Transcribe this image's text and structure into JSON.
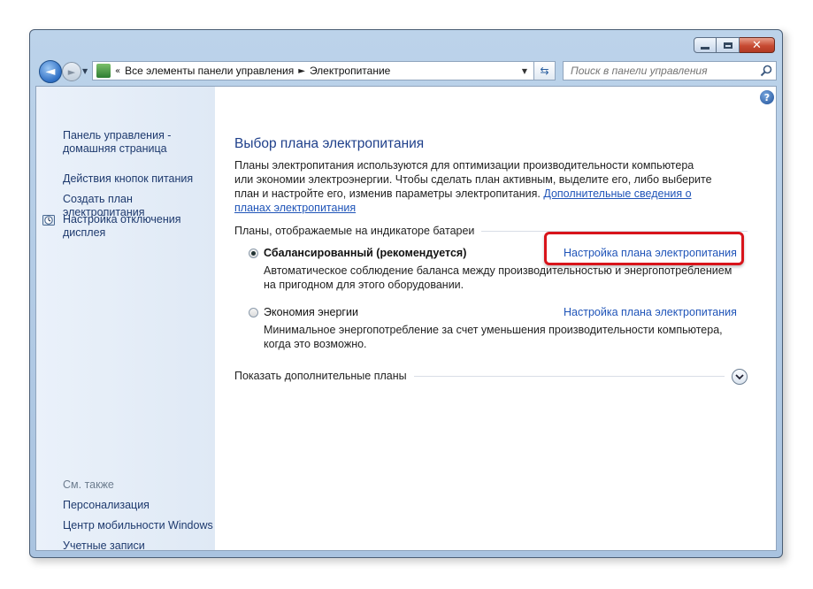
{
  "window": {
    "min_glyph": "minimize",
    "close_glyph": "✕"
  },
  "navbar": {
    "back": "back-arrow",
    "forward": "forward-arrow",
    "breadcrumb": [
      "Все элементы панели управления",
      "Электропитание"
    ],
    "search_placeholder": "Поиск в панели управления"
  },
  "sidebar": {
    "links": [
      {
        "label": "Панель управления - домашняя страница"
      },
      {
        "label": "Действия кнопок питания"
      },
      {
        "label": "Создать план электропитания"
      },
      {
        "label": "Настройка отключения дисплея"
      }
    ],
    "see_also": "См. также",
    "see_also_links": [
      {
        "label": "Персонализация"
      },
      {
        "label": "Центр мобильности Windows"
      },
      {
        "label": "Учетные записи пользователей"
      }
    ]
  },
  "main": {
    "title": "Выбор плана электропитания",
    "description": "Планы электропитания используются для оптимизации производительности компьютера или экономии электроэнергии. Чтобы сделать план активным, выделите его, либо выберите план и настройте его, изменив параметры электропитания.",
    "description_link": "Дополнительные сведения о планах электропитания",
    "group_title": "Планы, отображаемые на индикаторе батареи",
    "plans": [
      {
        "name": "Сбалансированный (рекомендуется)",
        "selected": true,
        "description": "Автоматическое соблюдение баланса между производительностью и энергопотреблением на пригодном для этого оборудовании.",
        "link": "Настройка плана электропитания"
      },
      {
        "name": "Экономия энергии",
        "selected": false,
        "description": "Минимальное энергопотребление за счет уменьшения производительности компьютера, когда это возможно.",
        "link": "Настройка плана электропитания"
      }
    ],
    "more_plans": "Показать дополнительные планы",
    "help": "?"
  },
  "colors": {
    "link": "#1f54b8",
    "title": "#1e3f8a",
    "highlight": "#d8141b"
  }
}
